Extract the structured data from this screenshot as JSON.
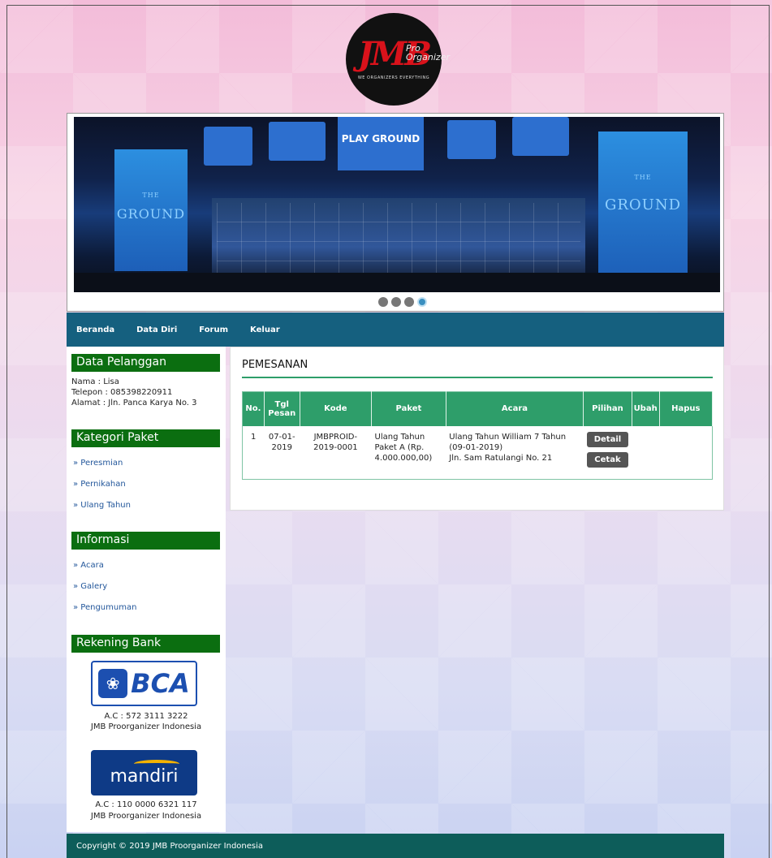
{
  "logo": {
    "main": "JMB",
    "side1": "Pro",
    "side2": "Organizer",
    "tagline": "WE ORGANIZERS EVERYTHING"
  },
  "banner": {
    "sign": "PLAY GROUND",
    "left_pillar": "GROUND",
    "right_pillar": "GROUND",
    "right_pillar_top": "THE",
    "left_pillar_top": "THE",
    "slide_count": 4,
    "active_slide": 4
  },
  "nav": [
    "Beranda",
    "Data Diri",
    "Forum",
    "Keluar"
  ],
  "sidebar": {
    "customer_heading": "Data Pelanggan",
    "customer_name": "Nama : Lisa",
    "customer_phone": "Telepon : 085398220911",
    "customer_address": "Alamat : Jln. Panca Karya No. 3",
    "category_heading": "Kategori Paket",
    "categories": [
      "» Peresmian",
      "» Pernikahan",
      "» Ulang Tahun"
    ],
    "info_heading": "Informasi",
    "info_links": [
      "» Acara",
      "» Galery",
      "» Pengumuman"
    ],
    "bank_heading": "Rekening Bank",
    "bca_label": "BCA",
    "bca_account": "A.C : 572 3111 3222",
    "bca_owner": "JMB Proorganizer Indonesia",
    "mandiri_label": "mandiri",
    "mandiri_account": "A.C : 110 0000 6321 117",
    "mandiri_owner": "JMB Proorganizer Indonesia"
  },
  "main": {
    "title": "PEMESANAN",
    "columns": [
      "No.",
      "Tgl Pesan",
      "Kode",
      "Paket",
      "Acara",
      "Pilihan",
      "Ubah",
      "Hapus"
    ],
    "rows": [
      {
        "no": "1",
        "date": "07-01-2019",
        "code": "JMBPROID-2019-0001",
        "package": "Ulang Tahun Paket A (Rp. 4.000.000,00)",
        "event": "Ulang Tahun William 7 Tahun (09-01-2019)",
        "address": "Jln. Sam Ratulangi No. 21",
        "detail_label": "Detail",
        "print_label": "Cetak"
      }
    ]
  },
  "footer": {
    "text": "Copyright © 2019 JMB Proorganizer Indonesia"
  },
  "colors": {
    "nav": "#15607f",
    "side_heading": "#0b6e10",
    "table_header": "#2e9e6a",
    "footer": "#0d5d5a"
  }
}
